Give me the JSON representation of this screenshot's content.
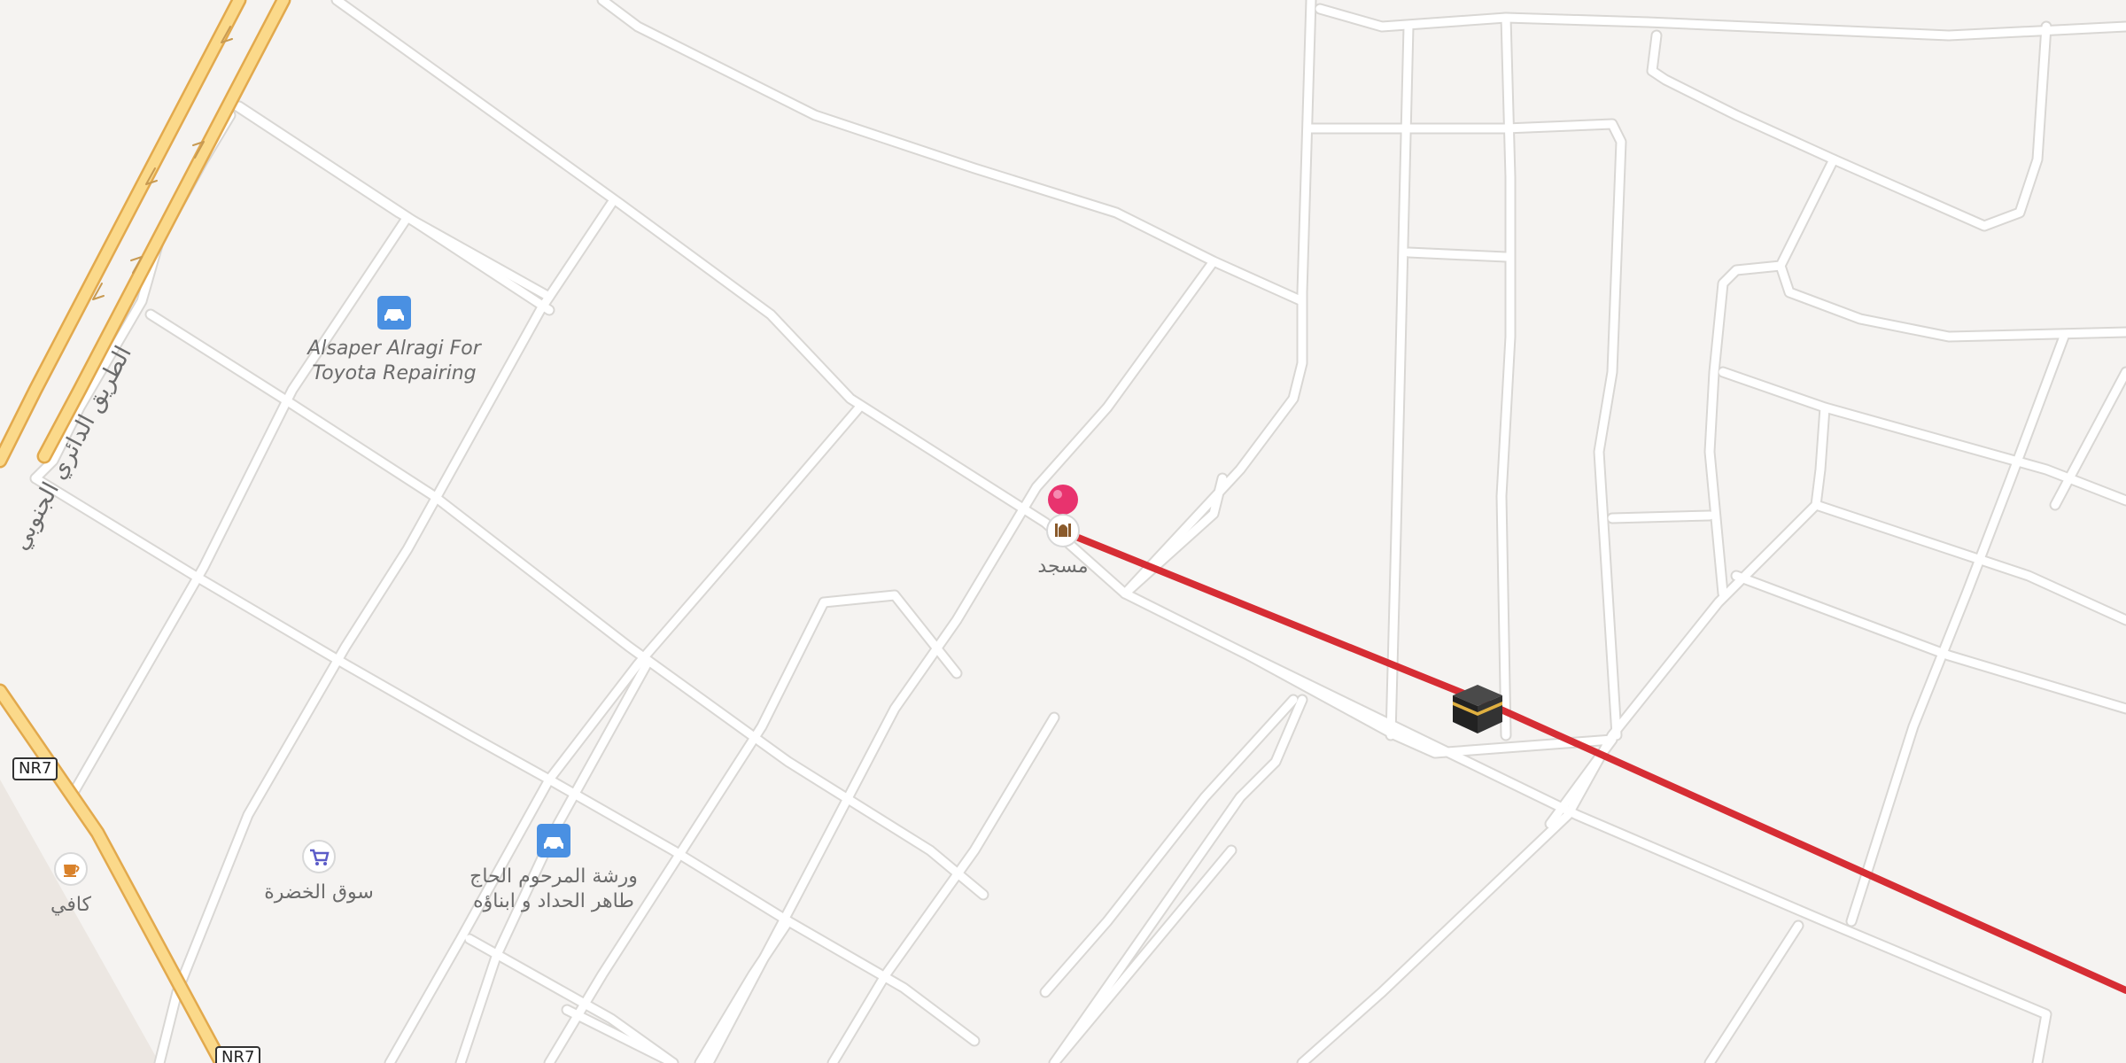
{
  "map": {
    "route_color": "#d62d34",
    "pin_color": "#e8336e",
    "road_color": "#ffffff",
    "road_casing": "#dadada",
    "highway_color": "#fbd98a",
    "highway_casing": "#e2a94d"
  },
  "pois": {
    "toyota": {
      "label_line1": "Alsaper Alragi For",
      "label_line2": "Toyota Repairing",
      "icon": "car-icon"
    },
    "mosque": {
      "label": "مسجد",
      "icon": "mosque-icon"
    },
    "market": {
      "label": "سوق الخضرة",
      "icon": "shopping-cart-icon"
    },
    "workshop": {
      "label_line1": "ورشة المرحوم الحاج",
      "label_line2": "طاهر الحداد و ابناؤه",
      "icon": "car-icon"
    },
    "cafe": {
      "label": "كافي",
      "icon": "coffee-cup-icon"
    },
    "kaaba": {
      "icon": "kaaba-icon"
    }
  },
  "roads": {
    "highway_label": "الطريق الدائري الجنوبي",
    "shield_1": "NR7",
    "shield_2": "NR7"
  }
}
